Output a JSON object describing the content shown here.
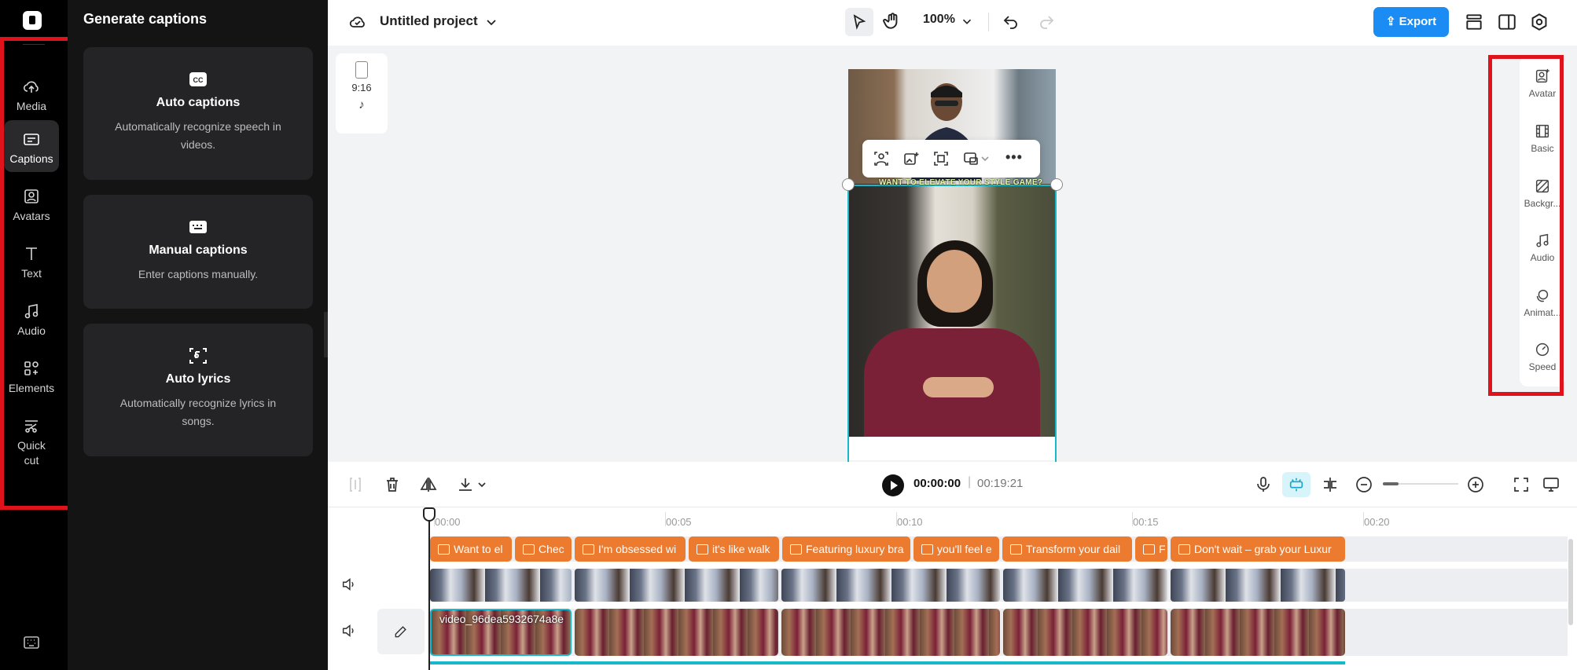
{
  "app": {
    "project_title": "Untitled project",
    "zoom": "100%",
    "export_label": "Export"
  },
  "nav": {
    "items": [
      {
        "label": "Media",
        "icon": "cloud-upload-icon"
      },
      {
        "label": "Captions",
        "icon": "captions-icon",
        "active": true
      },
      {
        "label": "Avatars",
        "icon": "avatar-icon"
      },
      {
        "label": "Text",
        "icon": "text-icon"
      },
      {
        "label": "Audio",
        "icon": "music-note-icon"
      },
      {
        "label": "Elements",
        "icon": "elements-icon"
      },
      {
        "label": "Quick",
        "label2": "cut",
        "icon": "scissors-icon"
      }
    ]
  },
  "panel": {
    "title": "Generate captions",
    "cards": [
      {
        "title": "Auto captions",
        "desc": "Automatically recognize speech in videos.",
        "icon": "cc-icon"
      },
      {
        "title": "Manual captions",
        "desc": "Enter captions manually.",
        "icon": "keyboard-icon"
      },
      {
        "title": "Auto lyrics",
        "desc": "Automatically recognize lyrics in songs.",
        "icon": "lyrics-icon"
      }
    ]
  },
  "canvas": {
    "aspect_ratio": "9:16",
    "caption_overlay": "WANT TO ELEVATE YOUR STYLE GAME?"
  },
  "right_sidebar": {
    "items": [
      {
        "label": "Avatar",
        "icon": "avatar-plus-icon"
      },
      {
        "label": "Basic",
        "icon": "film-icon"
      },
      {
        "label": "Backgr...",
        "icon": "background-icon"
      },
      {
        "label": "Audio",
        "icon": "music-note-icon"
      },
      {
        "label": "Animat...",
        "icon": "animation-icon"
      },
      {
        "label": "Speed",
        "icon": "speed-icon"
      }
    ]
  },
  "timeline": {
    "current_time": "00:00:00",
    "separator": "|",
    "total_time": "00:19:21",
    "ruler": [
      "00:00",
      "00:05",
      "00:10",
      "00:15",
      "00:20"
    ],
    "caption_clips": [
      "Want to el",
      "Chec",
      "I'm obsessed wi",
      "it's like walk",
      "Featuring luxury bra",
      "you'll feel e",
      "Transform your dail",
      "F",
      "Don't wait – grab your Luxur"
    ],
    "video_clip_name": "video_96dea5932674a8e"
  },
  "colors": {
    "accent": "#1c8cf5",
    "caption_chip": "#ec7a2f",
    "selection": "#16b8c9",
    "highlight_box": "#e0121b"
  }
}
